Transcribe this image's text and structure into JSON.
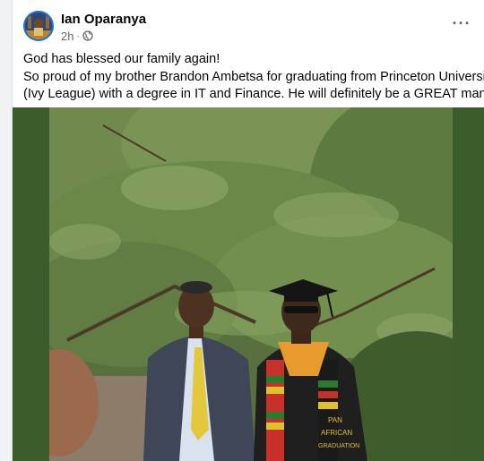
{
  "post": {
    "author": "Ian Oparanya",
    "time": "2h",
    "separator": "·",
    "audience_icon": "globe-icon",
    "more_icon": "more-options-icon",
    "more_label": "···",
    "text_line_1": "God has blessed our family again!",
    "text_line_2": "So proud of my brother Brandon Ambetsa for graduating from Princeton University",
    "text_line_3": "(Ivy League) with a degree in IT and Finance. He will definitely be a GREAT man",
    "emoji": "heart-icon",
    "photo": {
      "subject": "two men posing outdoors in front of a pine tree",
      "stole_text_1": "PAN",
      "stole_text_2": "AFRICAN",
      "stole_text_3": "GRADUATION"
    }
  },
  "colors": {
    "link_blue": "#1b74e4",
    "meta_gray": "#65676b",
    "frame_green": "#3d5c2b",
    "heart_red": "#e41e3f"
  }
}
